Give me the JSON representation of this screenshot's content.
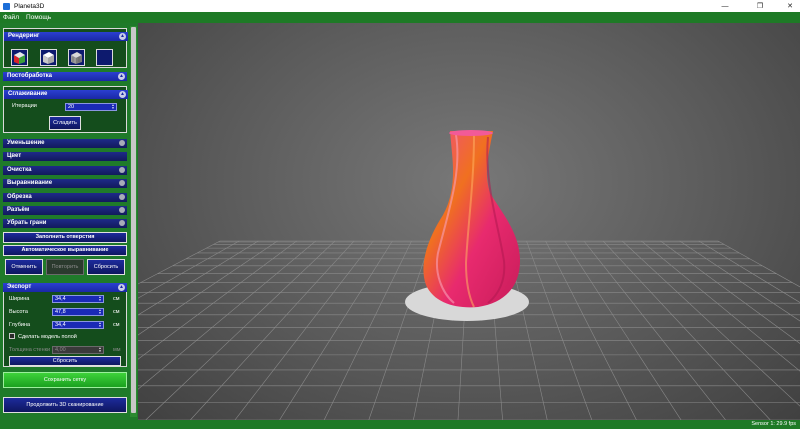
{
  "window": {
    "title": "Planeta3D"
  },
  "menu": {
    "file": "Файл",
    "help": "Помощь"
  },
  "sections": {
    "rendering": "Рендеринг",
    "postprocessing": "Постобработка",
    "smoothing": "Сглаживание",
    "reduction": "Уменьшение",
    "color": "Цвет",
    "cleaning": "Очистка",
    "alignment": "Выравнивание",
    "trim": "Обрезка",
    "cut": "Разъём",
    "remove_edges": "Убрать грани",
    "export": "Экспорт"
  },
  "smoothing": {
    "iterations_label": "Итерации",
    "iterations_value": "20",
    "smooth_button": "Сгладить"
  },
  "buttons": {
    "fill_holes": "Заполнить отверстия",
    "auto_align": "Автоматическое выравнивание",
    "undo": "Отменить",
    "redo": "Повторить",
    "reset": "Сбросить",
    "export_reset": "Сбросить",
    "save_mesh": "Сохранить сетку",
    "continue_scan": "Продолжить 3D сканирование"
  },
  "export": {
    "width_label": "Ширина",
    "width_value": "34,4",
    "height_label": "Высота",
    "height_value": "47,8",
    "depth_label": "Глубина",
    "depth_value": "34,4",
    "unit": "см",
    "hollow_label": "Сделать модель полой",
    "wall_label": "Толщина стенки",
    "wall_value": "4,00",
    "wall_unit": "мм"
  },
  "status": {
    "text": "Sensor 1: 29.9 fps"
  },
  "colors": {
    "panel_green": "#1f7a2a",
    "header_blue": "#2b3fd1",
    "save_green": "#2fbf2c",
    "vase_pink": "#e8246a",
    "vase_orange": "#f06a1a"
  }
}
